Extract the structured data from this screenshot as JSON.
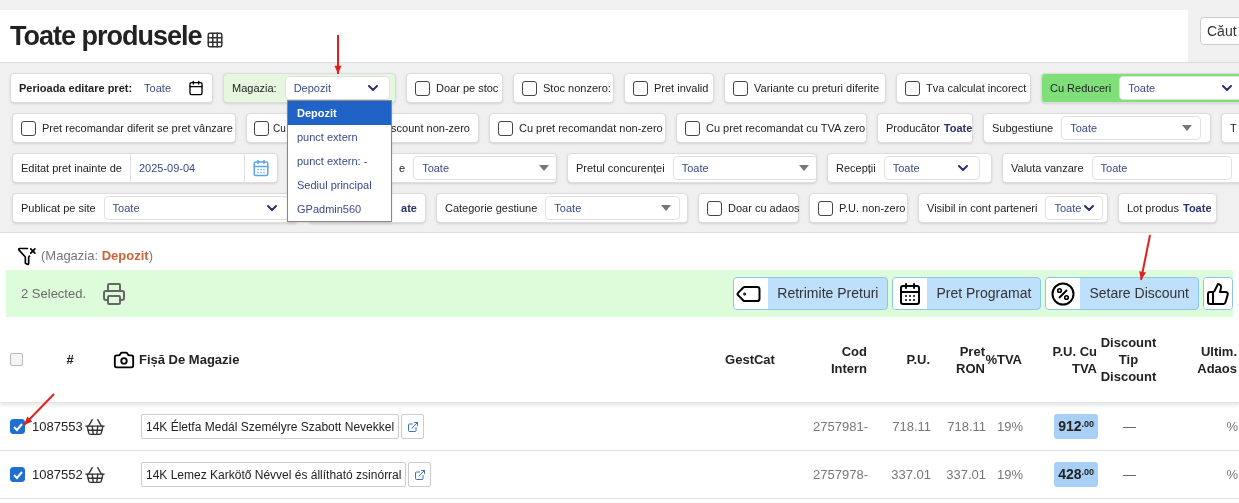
{
  "header": {
    "title": "Toate produsele",
    "search_placeholder": "Căut"
  },
  "filters": [
    [
      {
        "kind": "date_range",
        "label": "Perioada editare pret:",
        "value": "Toate"
      },
      {
        "kind": "select",
        "label": "Magazia:",
        "value": "Depozit",
        "color": "#e5f8df"
      },
      {
        "kind": "checkbox",
        "label": "Doar pe stoc",
        "checked": false
      },
      {
        "kind": "checkbox",
        "label": "Stoc nonzero:",
        "checked": false
      },
      {
        "kind": "checkbox",
        "label": "Pret invalid",
        "checked": false
      },
      {
        "kind": "checkbox",
        "label": "Variante cu preturi diferite",
        "checked": false
      },
      {
        "kind": "checkbox",
        "label": "Tva calculat incorect",
        "checked": false
      },
      {
        "kind": "select",
        "label": "Cu Reduceri",
        "value": "Toate",
        "color": "#7fe07a"
      }
    ],
    [
      {
        "kind": "checkbox",
        "label": "Pret recomandar diferit se pret vânzare",
        "checked": false
      },
      {
        "kind": "covered_checkbox",
        "label": "Cu",
        "label_after": "scount non-zero",
        "checked": false
      },
      {
        "kind": "checkbox",
        "label": "Cu pret recomandat non-zero",
        "checked": false
      },
      {
        "kind": "checkbox",
        "label": "Cu pret recomandat cu TVA zero",
        "checked": false
      },
      {
        "kind": "value",
        "label": "Producător",
        "value": "Toate"
      },
      {
        "kind": "combo",
        "label": "Subgestiune",
        "value": "Toate"
      },
      {
        "kind": "value",
        "label": "T"
      }
    ],
    [
      {
        "kind": "date",
        "label": "Editat pret inainte de",
        "value": "2025-09-04"
      },
      {
        "kind": "covered",
        "label": "e",
        "value": "Toate"
      },
      {
        "kind": "combo",
        "label": "Pretul concurenței",
        "value": "Toate"
      },
      {
        "kind": "select",
        "label": "Recepții",
        "value": "Toate"
      },
      {
        "kind": "field",
        "label": "Valuta vanzare",
        "value": "Toate"
      }
    ],
    [
      {
        "kind": "select",
        "label": "Publicat pe site",
        "value": "Toate"
      },
      {
        "kind": "covered_value",
        "value": "ate"
      },
      {
        "kind": "combo",
        "label": "Categorie gestiune",
        "value": "Toate"
      },
      {
        "kind": "checkbox",
        "label": "Doar cu adaos",
        "checked": false
      },
      {
        "kind": "checkbox",
        "label": "P.U. non-zero",
        "checked": false
      },
      {
        "kind": "select",
        "label": "Visibil in cont parteneri",
        "value": "Toate"
      },
      {
        "kind": "value",
        "label": "Lot produs",
        "value": "Toate"
      }
    ]
  ],
  "dropdown": {
    "options": [
      {
        "label": "Depozit",
        "selected": true
      },
      {
        "label": "punct extern",
        "selected": false
      },
      {
        "label": "punct extern: -",
        "selected": false
      },
      {
        "label": "Sediul principal",
        "selected": false
      },
      {
        "label": "GPadmin560",
        "selected": false
      }
    ]
  },
  "active_filter": "(Magazia: **Depozit**)",
  "selection": {
    "text": "2 Selected.",
    "actions": [
      {
        "kind": "tag",
        "label": "Retrimite Preturi"
      },
      {
        "kind": "calendar",
        "label": "Pret Programat"
      },
      {
        "kind": "percent",
        "label": "Setare Discount"
      },
      {
        "kind": "thumb"
      }
    ]
  },
  "table": {
    "select_all_checked": false,
    "columns": [
      [
        "#"
      ],
      [
        "Fișă De Magazie"
      ],
      [
        "GestCat"
      ],
      [
        "Cod",
        "Intern"
      ],
      [
        "P.U."
      ],
      [
        "Pret",
        "RON"
      ],
      [
        "%TVA"
      ],
      [
        "P.U. Cu",
        "TVA"
      ],
      [
        "Discount",
        "Tip",
        "Discount"
      ],
      [
        "Ultim.",
        "Adaos"
      ]
    ],
    "rows": [
      {
        "checked": true,
        "id": "1087553",
        "name": "14K Életfa Medál Személyre Szabott Nevekkel",
        "cod": "2757981-",
        "pu": "718.11",
        "pret_ron": "718.11",
        "tva": "19%",
        "pu_tva": "912$^{.00}$",
        "discount": "—",
        "adaos": "%"
      },
      {
        "checked": true,
        "id": "1087552",
        "name": "14K Lemez Karkötő Névvel és állítható zsinórral",
        "cod": "2757978-",
        "pu": "337.01",
        "pret_ron": "337.01",
        "tva": "19%",
        "pu_tva": "428$^{.00}$",
        "discount": "—",
        "adaos": "%"
      }
    ]
  }
}
